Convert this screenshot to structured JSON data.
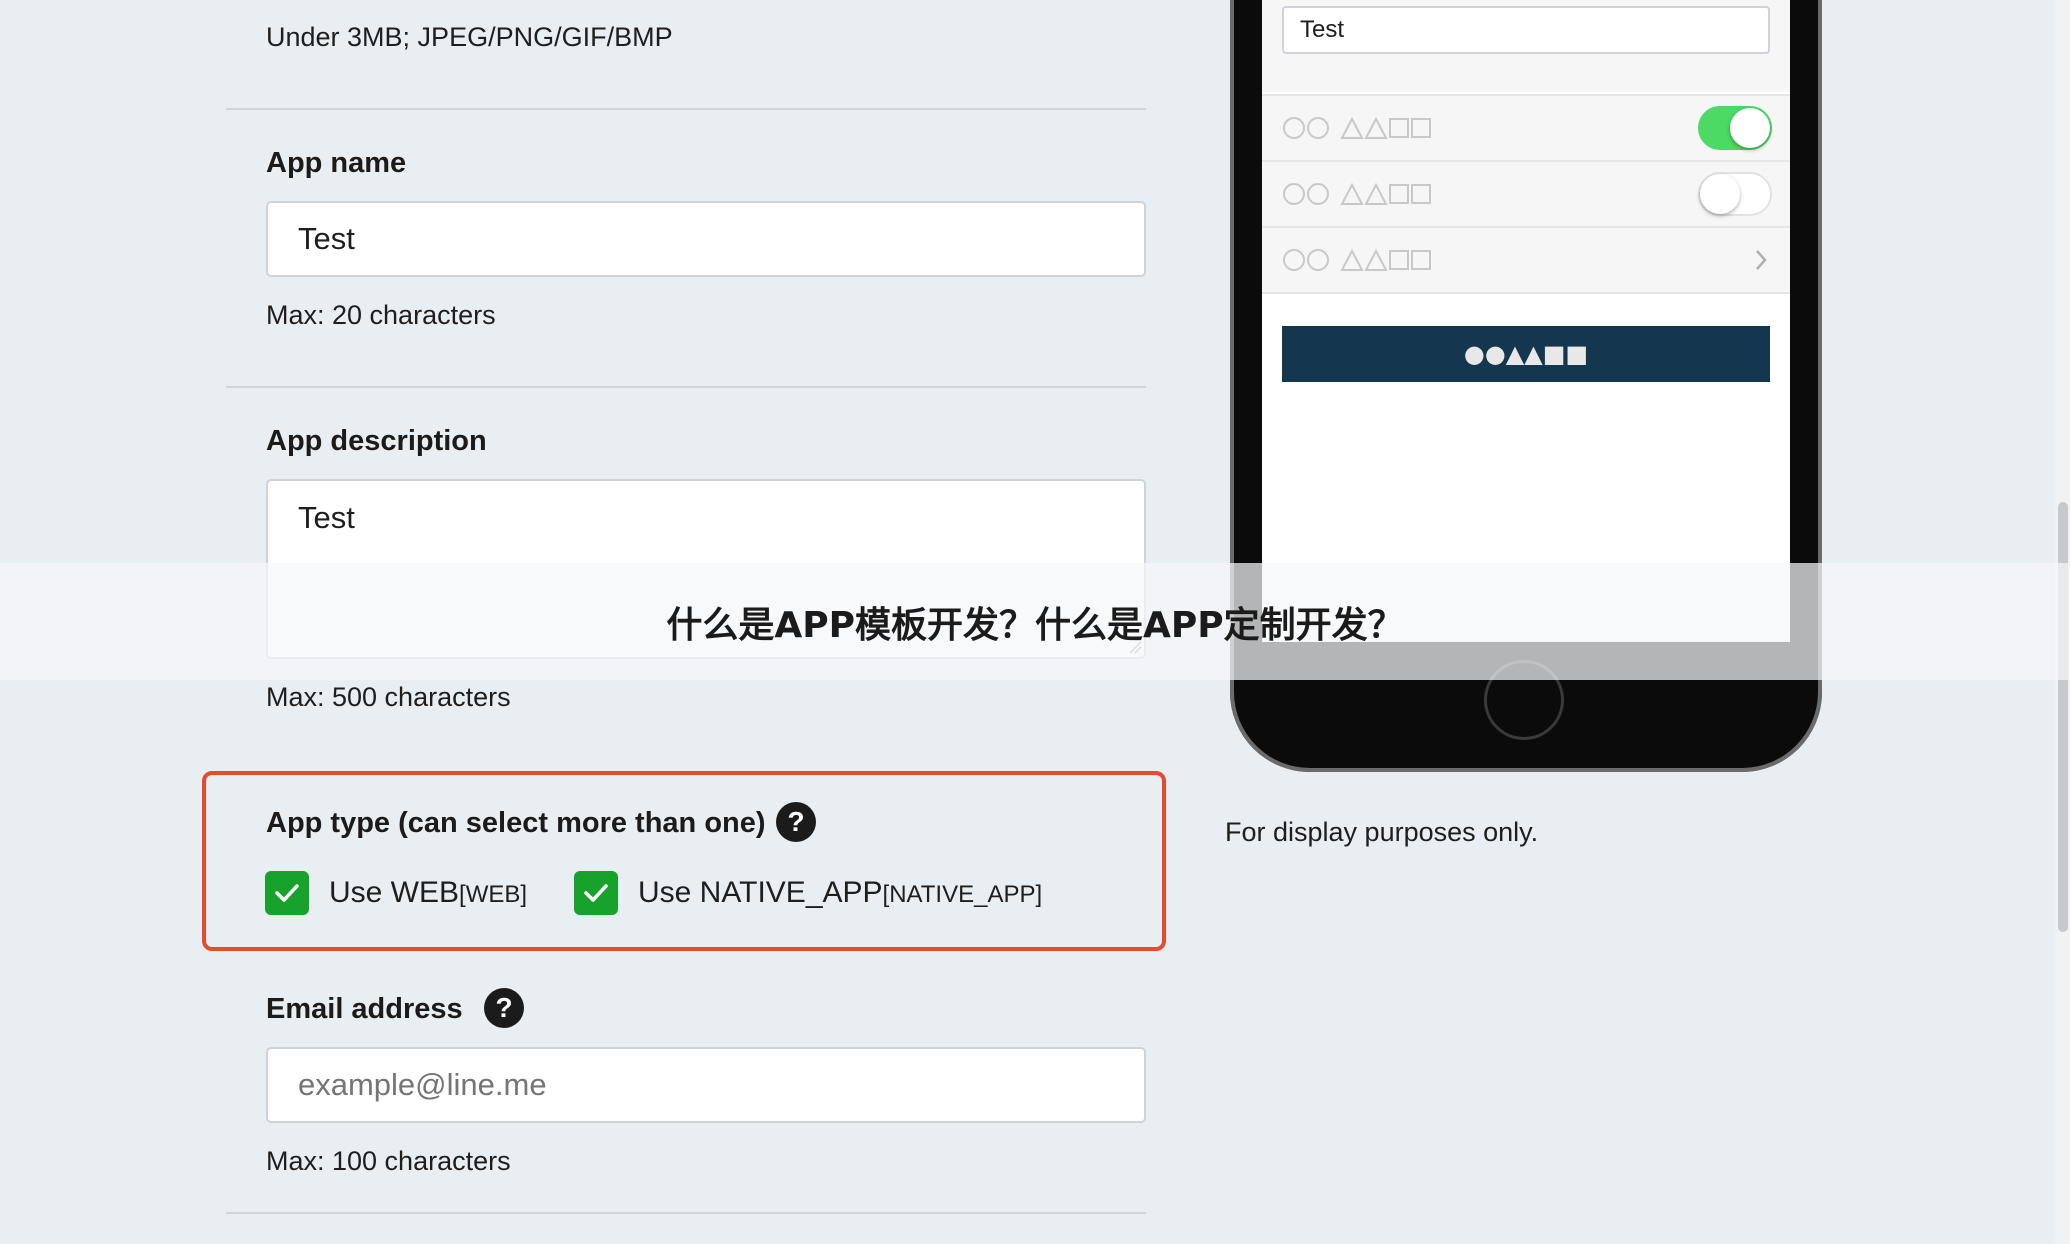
{
  "form": {
    "icon_hint": "Under 3MB; JPEG/PNG/GIF/BMP",
    "app_name": {
      "label": "App name",
      "value": "Test",
      "hint": "Max: 20 characters"
    },
    "app_description": {
      "label": "App description",
      "value": "Test",
      "hint": "Max: 500 characters"
    },
    "app_type": {
      "label": "App type (can select more than one)",
      "help": "?",
      "options": [
        {
          "label": "Use WEB",
          "tag": "[WEB]",
          "checked": true
        },
        {
          "label": "Use NATIVE_APP",
          "tag": "[NATIVE_APP]",
          "checked": true
        }
      ]
    },
    "email": {
      "label": "Email address",
      "help": "?",
      "placeholder": "example@line.me",
      "hint": "Max: 100 characters"
    }
  },
  "preview": {
    "input_value": "Test",
    "rows": [
      {
        "placeholder": "○○△△□□",
        "control": "toggle",
        "on": true
      },
      {
        "placeholder": "○○△△□□",
        "control": "toggle",
        "on": false
      },
      {
        "placeholder": "○○△△□□",
        "control": "chevron"
      }
    ],
    "button_label": "●●▲▲■■",
    "note": "For display purposes only."
  },
  "banner": {
    "text": "什么是APP模板开发？什么是APP定制开发？"
  },
  "colors": {
    "accent_green": "#17a32b",
    "toggle_on": "#4cd964",
    "button_navy": "#14364f",
    "highlight_red": "#e74a2f"
  }
}
